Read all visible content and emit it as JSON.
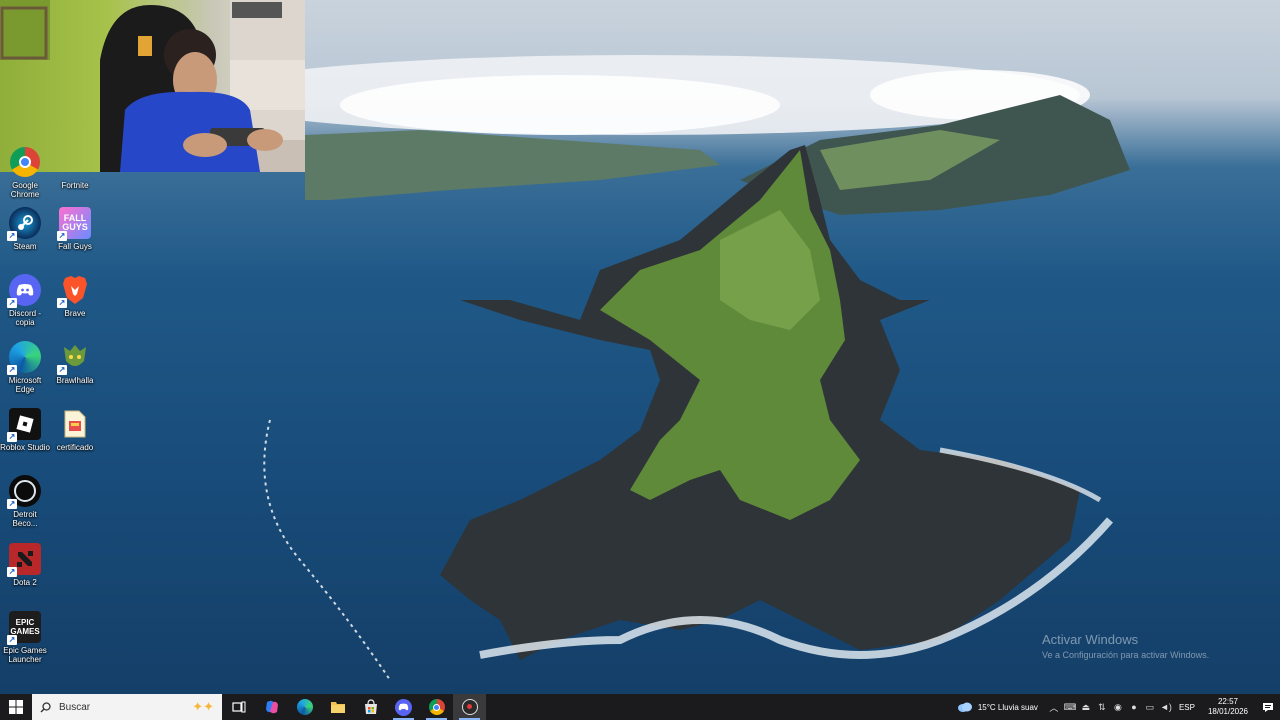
{
  "desktop": {
    "icons": [
      {
        "label": "Google Chrome",
        "icon": "chrome-icon"
      },
      {
        "label": "Fortnite",
        "icon": "fortnite-icon"
      },
      {
        "label": "Steam",
        "icon": "steam-icon"
      },
      {
        "label": "Fall Guys",
        "icon": "fall-guys-icon"
      },
      {
        "label": "Discord - copia",
        "icon": "discord-icon"
      },
      {
        "label": "Brave",
        "icon": "brave-icon"
      },
      {
        "label": "Microsoft Edge",
        "icon": "edge-icon"
      },
      {
        "label": "Brawlhalla",
        "icon": "brawlhalla-icon"
      },
      {
        "label": "Roblox Studio",
        "icon": "roblox-studio-icon"
      },
      {
        "label": "certificado",
        "icon": "document-icon"
      },
      {
        "label": "Detroit Beco...",
        "icon": "detroit-icon"
      },
      {
        "label": "Dota 2",
        "icon": "dota2-icon"
      },
      {
        "label": "Epic Games Launcher",
        "icon": "epic-games-icon"
      }
    ],
    "watermark": {
      "line1": "Activar Windows",
      "line2": "Ve a Configuración para activar Windows."
    }
  },
  "taskbar": {
    "search_placeholder": "Buscar",
    "apps": [
      {
        "icon": "task-view-icon"
      },
      {
        "icon": "copilot-icon"
      },
      {
        "icon": "edge-icon"
      },
      {
        "icon": "file-explorer-icon"
      },
      {
        "icon": "store-icon"
      },
      {
        "icon": "discord-icon"
      },
      {
        "icon": "chrome-icon"
      },
      {
        "icon": "recorder-icon"
      }
    ],
    "weather": "15°C  Lluvia suav",
    "language": "ESP",
    "time": "22:57",
    "date": "18/01/2026"
  },
  "colors": {
    "taskbar_bg": "#1b1b1d",
    "accent": "#8ab4f8",
    "discord": "#5865f2",
    "brave": "#fb542b",
    "dota": "#b8282b"
  }
}
